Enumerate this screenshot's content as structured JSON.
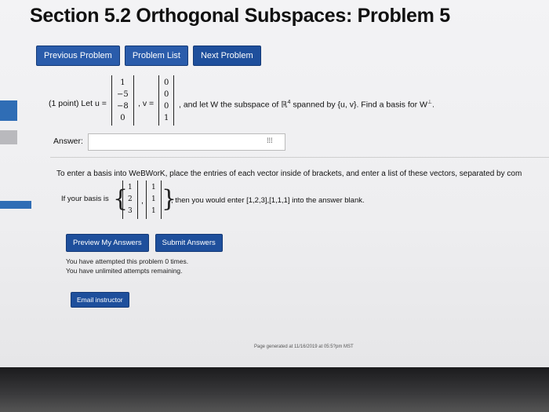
{
  "page": {
    "title": "Section 5.2 Orthogonal Subspaces: Problem 5"
  },
  "nav": {
    "previous": "Previous Problem",
    "list": "Problem List",
    "next": "Next Problem"
  },
  "problem": {
    "points": "(1 point) Let u =",
    "v_label": ", v =",
    "mid_text": ", and let W the subspace of ℝ",
    "superscript": "4",
    "tail_text": "spanned by {u, v}. Find a basis for W",
    "perp": "⊥",
    "end": ".",
    "u": [
      "1",
      "−5",
      "−8",
      "0"
    ],
    "v": [
      "0",
      "0",
      "0",
      "1"
    ]
  },
  "answer": {
    "label": "Answer:",
    "value": "",
    "grid_icon": "grid-icon"
  },
  "instructions": {
    "line1": "To enter a basis into WeBWorK, place the entries of each vector inside of brackets, and enter a list of these vectors, separated by com",
    "if_label": "If your basis is",
    "example_v1": [
      "1",
      "2",
      "3"
    ],
    "example_v2": [
      "1",
      "1",
      "1"
    ],
    "then_text": ", then you would enter [1,2,3],[1,1,1] into the answer blank."
  },
  "actions": {
    "preview": "Preview My Answers",
    "submit": "Submit Answers"
  },
  "attempts": {
    "line1": "You have attempted this problem 0 times.",
    "line2": "You have unlimited attempts remaining."
  },
  "email": {
    "label": "Email instructor"
  },
  "footer": {
    "text": "Page generated at 11/16/2019 at 05:5?pm MST"
  }
}
